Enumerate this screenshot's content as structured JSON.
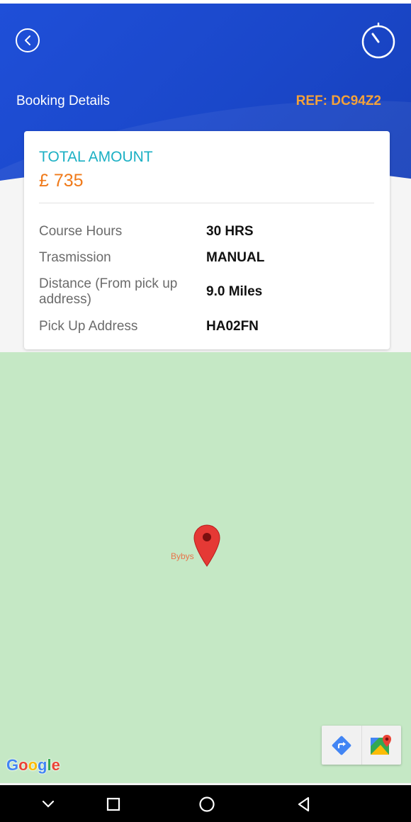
{
  "header": {
    "title": "Booking Details",
    "ref": "REF: DC94Z2",
    "back_icon": "chevron-left-icon",
    "timer_icon": "stopwatch-icon"
  },
  "summary": {
    "total_label": "TOTAL AMOUNT",
    "total_value": "£ 735"
  },
  "details": [
    {
      "label": "Course Hours",
      "value": "30 HRS"
    },
    {
      "label": "Trasmission",
      "value": "MANUAL"
    },
    {
      "label": "Distance (From pick up address)",
      "value": "9.0 Miles"
    },
    {
      "label": "Pick Up Address",
      "value": "HA02FN"
    }
  ],
  "map": {
    "marker_label": "Bybys",
    "attribution": "Google",
    "tools": [
      "directions-icon",
      "google-maps-icon"
    ]
  },
  "colors": {
    "header_blue": "#1f4fd8",
    "accent_orange": "#f07a1a",
    "ref_orange": "#f4a23a",
    "teal": "#1bb0c4",
    "map_green": "#c5e8c5"
  },
  "system_nav": [
    "chevron-down-icon",
    "recents-square-icon",
    "home-circle-icon",
    "back-triangle-icon"
  ]
}
